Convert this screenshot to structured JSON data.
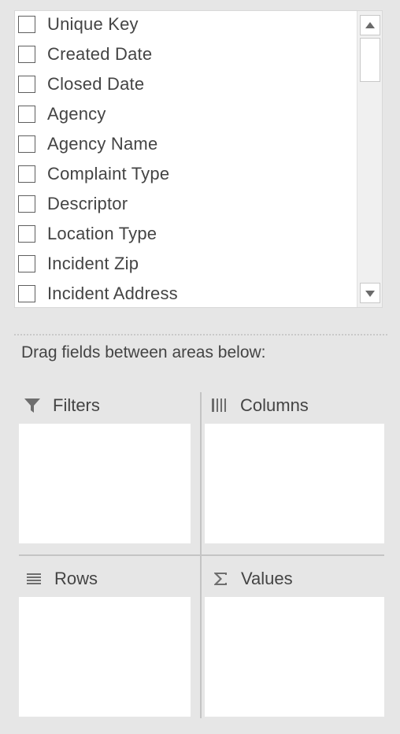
{
  "field_list": {
    "fields": [
      {
        "label": "Unique Key",
        "checked": false
      },
      {
        "label": "Created Date",
        "checked": false
      },
      {
        "label": "Closed Date",
        "checked": false
      },
      {
        "label": "Agency",
        "checked": false
      },
      {
        "label": "Agency Name",
        "checked": false
      },
      {
        "label": "Complaint Type",
        "checked": false
      },
      {
        "label": "Descriptor",
        "checked": false
      },
      {
        "label": "Location Type",
        "checked": false
      },
      {
        "label": "Incident Zip",
        "checked": false
      },
      {
        "label": "Incident Address",
        "checked": false
      }
    ]
  },
  "instruction": "Drag fields between areas below:",
  "areas": {
    "filters": {
      "label": "Filters",
      "icon": "filter-icon"
    },
    "columns": {
      "label": "Columns",
      "icon": "columns-icon"
    },
    "rows": {
      "label": "Rows",
      "icon": "rows-icon"
    },
    "values": {
      "label": "Values",
      "icon": "sigma-icon"
    }
  }
}
